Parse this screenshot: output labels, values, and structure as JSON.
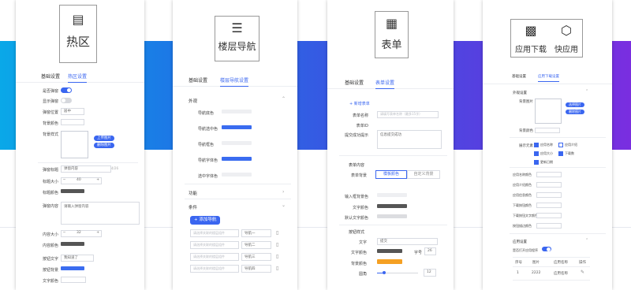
{
  "colors": {
    "accent": "#3a66f0",
    "band_start": "#0aa8e8",
    "band_end": "#7a2ee0",
    "dark_fill": "#555555",
    "orange": "#f5a023"
  },
  "p1": {
    "title": "热区",
    "icon": "list-box-icon",
    "tabs": [
      "基础设置",
      "热区设置"
    ],
    "labels": [
      "是否弹窗",
      "显示弹窗",
      "弹窗位置",
      "背景颜色",
      "背景样式",
      "弹窗标题",
      "标题大小",
      "标题颜色",
      "弹窗内容",
      "内容大小",
      "内容颜色",
      "按钮文字",
      "按钮背景",
      "文字颜色"
    ],
    "pos_value": "居中",
    "upload_btn": "上传图片",
    "delete_btn": "删除图片",
    "title_value": "弹窗内容",
    "counter": "4/26",
    "size1": "40",
    "content_ph": "请输入弹窗内容",
    "size2": "32",
    "button_value": "我知道了"
  },
  "p2": {
    "title": "楼层导航",
    "icon": "layers-icon",
    "tabs": [
      "基础设置",
      "楼层导航设置"
    ],
    "sec1": "外观",
    "labels": [
      "导航底色",
      "导航选中色",
      "导航框色",
      "导航字体色",
      "选中字体色"
    ],
    "sec2": "功能",
    "sec3": "条件",
    "add_btn": "添加导航",
    "rows": [
      {
        "select": "请选择关联的楼层组件",
        "name": "导航一"
      },
      {
        "select": "请选择关联的楼层组件",
        "name": "导航二"
      },
      {
        "select": "请选择关联的楼层组件",
        "name": "导航三"
      },
      {
        "select": "请选择关联的楼层组件",
        "name": "导航四"
      }
    ]
  },
  "p3": {
    "title": "表单",
    "icon": "form-icon",
    "tabs": [
      "基础设置",
      "表单设置"
    ],
    "add_link": "+ 新增表单",
    "labels": [
      "表单名称",
      "表单ID",
      "提交成功提示"
    ],
    "name_ph": "请填写表单名称（最多15字）",
    "success_value": "信息提交成功",
    "sec1": "表单内容",
    "bg_label": "表单背景",
    "seg": [
      "模板颜色",
      "自定义背景"
    ],
    "labels2": [
      "输入框背景色",
      "文字颜色",
      "默认文字颜色"
    ],
    "sec2": "按钮样式",
    "labels3": [
      "文字",
      "文字颜色",
      "背景颜色",
      "圆角"
    ],
    "btn_text": "提交",
    "size_label": "字号",
    "size_value": "26",
    "radius_value": "12"
  },
  "p4": {
    "title1": "应用下载",
    "icon1": "bag-icon",
    "title2": "快应用",
    "icon2": "cube-icon",
    "tabs": [
      "基础设置",
      "应用下载设置"
    ],
    "sec1": "外观设置",
    "pic_label": "背景图片",
    "upload_btn": "选择图片",
    "delete_btn": "删除图片",
    "bg_label": "背景颜色",
    "show_label": "展示元素",
    "checks": [
      "应用名称",
      "应用介绍",
      "应用大小",
      "下载数",
      "更新日期"
    ],
    "labels": [
      "应用名称颜色",
      "应用介绍颜色",
      "应用信息颜色",
      "下载按钮颜色",
      "下载按钮文字颜色",
      "按钮描边颜色"
    ],
    "sec2": "应用设置",
    "switch_label": "是否打开应用程序",
    "table_head": [
      "序号",
      "图片",
      "应用名称",
      "操作"
    ],
    "table_row": [
      "1",
      "2222",
      "应用名称"
    ]
  }
}
